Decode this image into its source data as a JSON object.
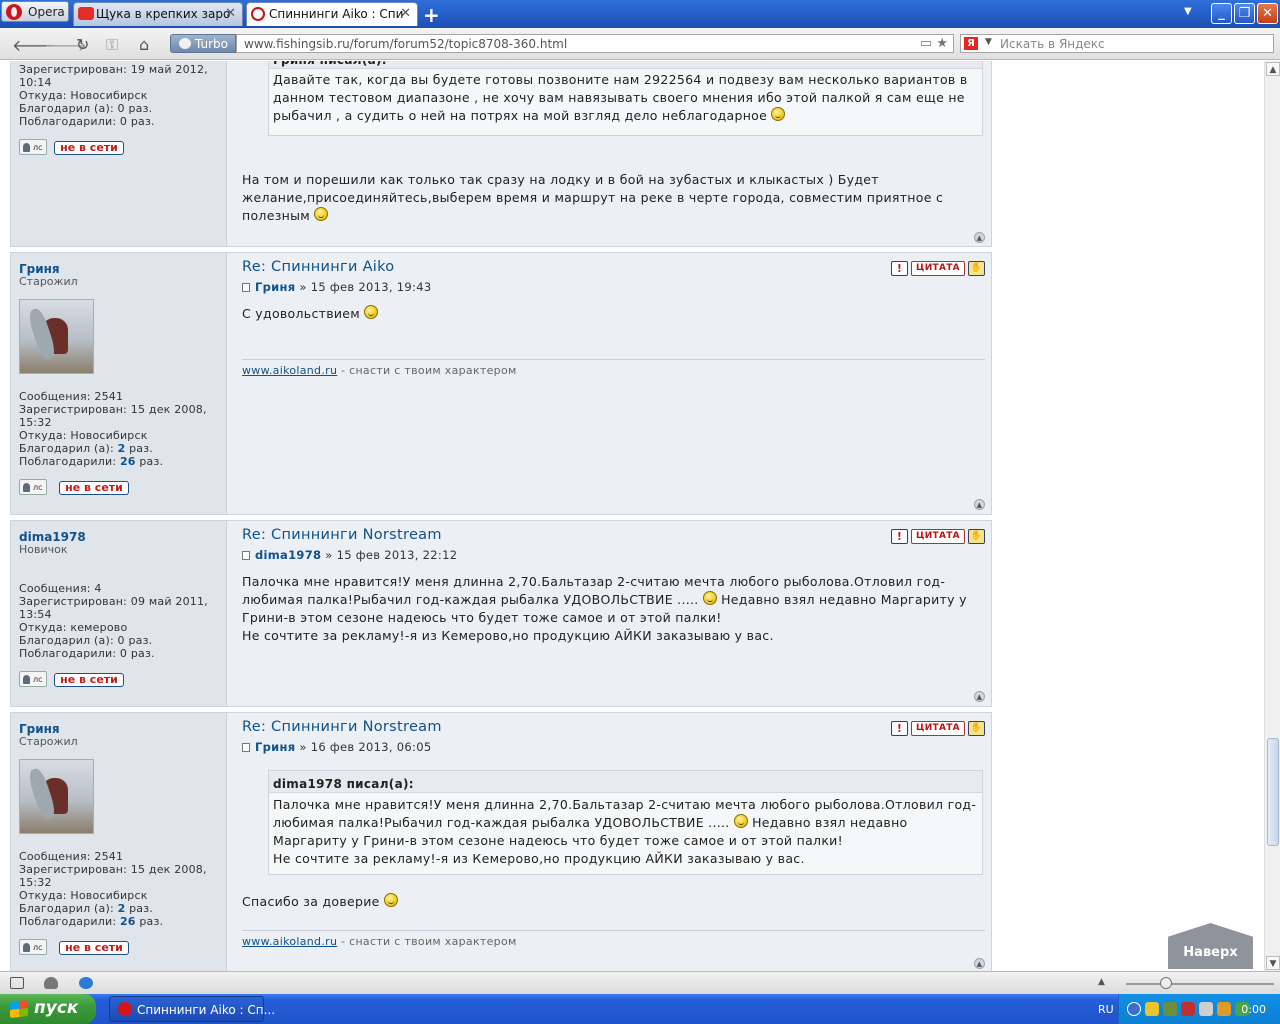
{
  "browser": {
    "opera_label": "Opera",
    "tabs": [
      {
        "title": "Щука в крепких заросл..."
      },
      {
        "title": "Спиннинги Aiko : Спин..."
      }
    ],
    "turbo_label": "Turbo",
    "url": "www.fishingsib.ru/forum/forum52/topic8708-360.html",
    "search_placeholder": "Искать в Яндекс",
    "search_logo": "Я"
  },
  "post0": {
    "registered": "Зарегистрирован: 19 май 2012, 10:14",
    "from": "Откуда: Новосибирск",
    "thanked": "Благодарил (а): 0 раз.",
    "thanks_received": "Поблагодарили: 0 раз.",
    "quote_header": "Гриня писал(а):",
    "quote_text": "Давайте так, когда вы будете готовы позвоните нам 2922564 и подвезу вам несколько вариантов в данном тестовом диапазоне , не хочу вам навязывать своего мнения ибо этой палкой я сам еще не рыбачил , а судить о ней на потрях на мой взгляд дело неблагодарное",
    "text": "На том и порешили как только так сразу на лодку и в бой на зубастых и клыкастых ) Будет желание,присоединяйтесь,выберем время и маршрут на реке в черте города, совместим приятное с полезным"
  },
  "post1": {
    "author": "Гриня",
    "rank": "Старожил",
    "posts": "Сообщения: 2541",
    "registered": "Зарегистрирован: 15 дек 2008, 15:32",
    "from": "Откуда: Новосибирск",
    "thanked_label": "Благодарил (а): ",
    "thanked_value": "2",
    "thanks_received_label": "Поблагодарили: ",
    "thanks_received_value": "26",
    "times": " раз.",
    "title": "Re: Спиннинги Aiko",
    "date": " » 15 фев 2013, 19:43",
    "text": "С удовольствием",
    "sig_link": "www.aikoland.ru",
    "sig_text": " - снасти с твоим характером"
  },
  "post2": {
    "author": "dima1978",
    "rank": "Новичок",
    "posts": "Сообщения: 4",
    "registered": "Зарегистрирован: 09 май 2011, 13:54",
    "from": "Откуда: кемерово",
    "thanked": "Благодарил (а): 0 раз.",
    "thanks_received": "Поблагодарили: 0 раз.",
    "title": "Re: Спиннинги Norstream",
    "date": " » 15 фев 2013, 22:12",
    "text_part1": "Палочка мне нравится!У меня длинна 2,70.Бальтазар 2-считаю мечта любого рыболова.Отловил год-любимая палка!Рыбачил год-каждая рыбалка УДОВОЛЬСТВИЕ .....",
    "text_part2": " Недавно взял недавно Маргариту у Грини-в этом сезоне надеюсь что будет тоже самое и от этой палки!",
    "text_part3": "Не сочтите за рекламу!-я из Кемерово,но продукцию АЙКИ заказываю у вас."
  },
  "post3": {
    "author": "Гриня",
    "rank": "Старожил",
    "posts": "Сообщения: 2541",
    "registered": "Зарегистрирован: 15 дек 2008, 15:32",
    "from": "Откуда: Новосибирск",
    "thanked_label": "Благодарил (а): ",
    "thanked_value": "2",
    "thanks_received_label": "Поблагодарили: ",
    "thanks_received_value": "26",
    "times": " раз.",
    "title": "Re: Спиннинги Norstream",
    "date": " » 16 фев 2013, 06:05",
    "quote_header": "dima1978 писал(а):",
    "quote_part1": "Палочка мне нравится!У меня длинна 2,70.Бальтазар 2-считаю мечта любого рыболова.Отловил год-любимая палка!Рыбачил год-каждая рыбалка УДОВОЛЬСТВИЕ .....",
    "quote_part2": " Недавно взял недавно Маргариту у Грини-в этом сезоне надеюсь что будет тоже самое и от этой палки!",
    "quote_part3": "Не сочтите за рекламу!-я из Кемерово,но продукцию АЙКИ заказываю у вас.",
    "text": "Спасибо за доверие",
    "sig_link": "www.aikoland.ru",
    "sig_text": " - снасти с твоим характером"
  },
  "common": {
    "pm_label": "лс",
    "offline_label": "не в сети",
    "quote_btn": "ЦИТАТА",
    "report_btn": "!",
    "to_top_label": "Наверх"
  },
  "taskbar": {
    "start_label": "пуск",
    "task_title": "Спиннинги Aiko : Сп...",
    "lang": "RU",
    "clock": "0:00"
  },
  "colors": {
    "link": "#105289",
    "offline": "#c21d1d",
    "xp_blue": "#245edb"
  }
}
